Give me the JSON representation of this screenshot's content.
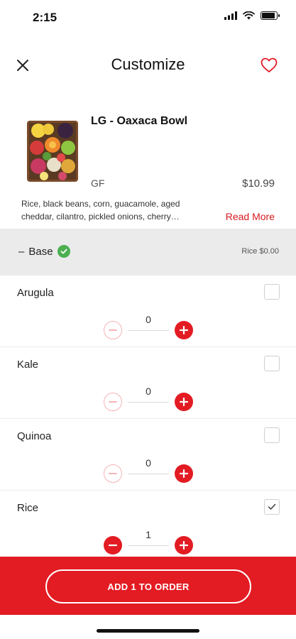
{
  "status_bar": {
    "time": "2:15"
  },
  "nav": {
    "title": "Customize"
  },
  "product": {
    "name": "LG - Oaxaca Bowl",
    "tag": "GF",
    "price": "$10.99",
    "description": "Rice, black beans, corn, guacamole, aged cheddar, cilantro, pickled onions, cherry…",
    "read_more": "Read More"
  },
  "section": {
    "toggle": "–",
    "title": "Base",
    "meta": "Rice $0.00"
  },
  "options": [
    {
      "name": "Arugula",
      "qty": "0",
      "checked": false
    },
    {
      "name": "Kale",
      "qty": "0",
      "checked": false
    },
    {
      "name": "Quinoa",
      "qty": "0",
      "checked": false
    },
    {
      "name": "Rice",
      "qty": "1",
      "checked": true
    }
  ],
  "footer": {
    "button_label": "ADD 1 TO ORDER"
  },
  "colors": {
    "brand_red": "#e31b23",
    "check_green": "#4caf50",
    "section_bg": "#ebebeb"
  },
  "icons": {
    "close": "close-icon",
    "favorite": "heart-outline-icon",
    "selected": "check-circle-icon",
    "minus": "minus-icon",
    "plus": "plus-icon",
    "wifi": "wifi-icon",
    "signal": "signal-icon",
    "battery": "battery-icon"
  }
}
